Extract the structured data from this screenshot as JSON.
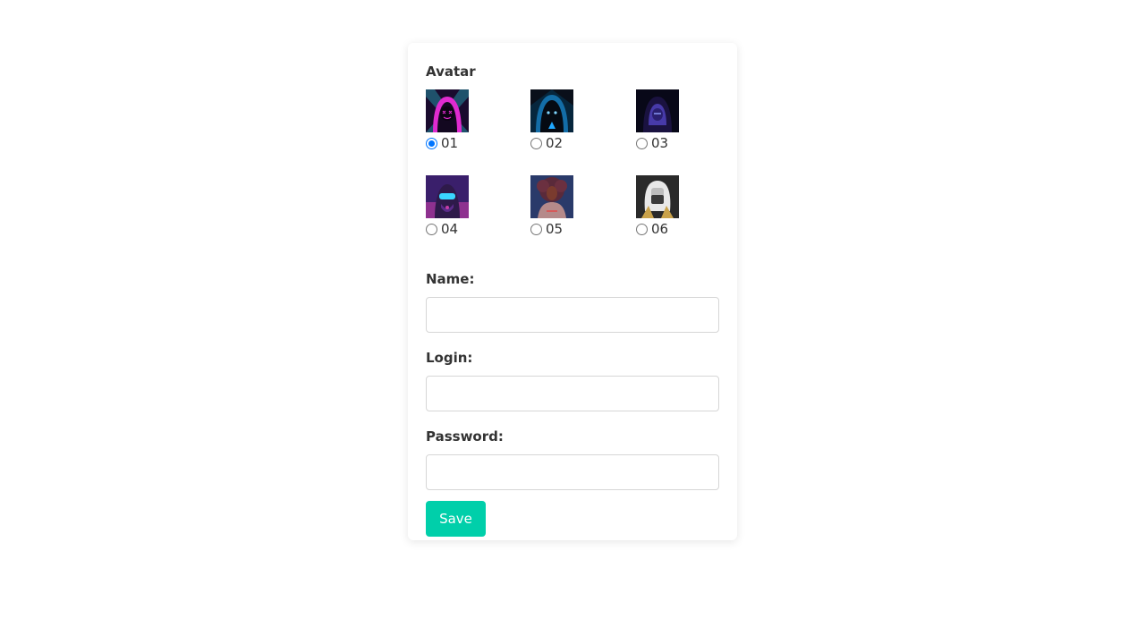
{
  "form": {
    "avatar_label": "Avatar",
    "avatars": [
      {
        "label": "01",
        "selected": true,
        "icon": "hooded-neon-figure-avatar",
        "colors": [
          "#1a0b2e",
          "#e02bd0",
          "#2bd6e0"
        ]
      },
      {
        "label": "02",
        "selected": false,
        "icon": "hooded-blue-glow-avatar",
        "colors": [
          "#06263d",
          "#1fa8ff",
          "#0a0f1a"
        ]
      },
      {
        "label": "03",
        "selected": false,
        "icon": "dark-hood-purple-avatar",
        "colors": [
          "#080818",
          "#5b4bd6",
          "#1a1240"
        ]
      },
      {
        "label": "04",
        "selected": false,
        "icon": "cyber-mask-avatar",
        "colors": [
          "#3a1f6b",
          "#c73ea7",
          "#2e1a4a"
        ]
      },
      {
        "label": "05",
        "selected": false,
        "icon": "curly-hair-woman-avatar",
        "colors": [
          "#2a3a6a",
          "#7a3b2e",
          "#b58a8a"
        ]
      },
      {
        "label": "06",
        "selected": false,
        "icon": "white-hair-mask-avatar",
        "colors": [
          "#2a2a2a",
          "#e8e8e8",
          "#c9a24a"
        ]
      }
    ],
    "name_label": "Name:",
    "name_value": "",
    "login_label": "Login:",
    "login_value": "",
    "password_label": "Password:",
    "password_value": "",
    "save_label": "Save"
  },
  "colors": {
    "accent": "#00cfaa",
    "radio_checked": "#0075ff",
    "text": "#333333",
    "input_border": "#d6d6d6"
  }
}
